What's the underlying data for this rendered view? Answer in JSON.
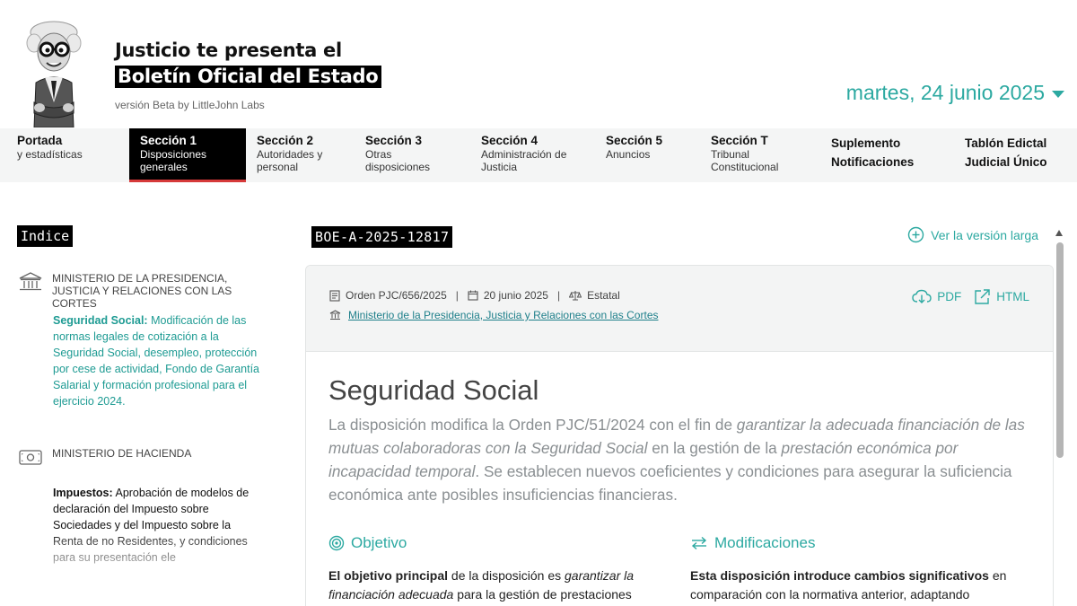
{
  "header": {
    "title_line1": "Justicio te presenta el",
    "title_line2": "Boletín Oficial del Estado",
    "version": "versión Beta by LittleJohn Labs",
    "date": "martes, 24 junio 2025"
  },
  "nav": [
    {
      "title": "Portada",
      "sub": "y estadísticas"
    },
    {
      "title": "Sección 1",
      "sub": "Disposiciones generales"
    },
    {
      "title": "Sección 2",
      "sub": "Autoridades y personal"
    },
    {
      "title": "Sección 3",
      "sub": "Otras disposiciones"
    },
    {
      "title": "Sección 4",
      "sub": "Administración de Justicia"
    },
    {
      "title": "Sección 5",
      "sub": "Anuncios"
    },
    {
      "title": "Sección T",
      "sub": "Tribunal Constitucional"
    },
    {
      "title": "Suplemento Notificaciones",
      "sub": ""
    },
    {
      "title": "Tablón Edictal Judicial Único",
      "sub": ""
    }
  ],
  "index": {
    "label": "Indice",
    "ministries": [
      {
        "name": "MINISTERIO DE LA PRESIDENCIA, JUSTICIA Y RELACIONES CON LAS CORTES",
        "icon": "government-building-icon",
        "entry_label": "Seguridad Social:",
        "entry_text": "Modificación de las normas legales de cotización a la Seguridad Social, desempleo, protección por cese de actividad, Fondo de Garantía Salarial y formación profesional para el ejercicio 2024."
      },
      {
        "name": "MINISTERIO DE HACIENDA",
        "icon": "banknote-icon",
        "entry_label": "Impuestos:",
        "entry_text": "Aprobación de modelos de declaración del Impuesto sobre Sociedades y del Impuesto sobre la Renta de no Residentes, y condiciones para su presentación ele"
      }
    ]
  },
  "document": {
    "id": "BOE-A-2025-12817",
    "long_version_label": "Ver la versión larga",
    "order": "Orden PJC/656/2025",
    "date": "20 junio 2025",
    "scope": "Estatal",
    "ministry_link": "Ministerio de la Presidencia, Justicia y Relaciones con las Cortes",
    "pdf_label": "PDF",
    "html_label": "HTML",
    "heading": "Seguridad Social",
    "lead": {
      "p1": "La disposición modifica la Orden PJC/51/2024 con el fin de ",
      "i1": "garantizar la adecuada financiación de las mutuas colaboradoras con la Seguridad Social",
      "p2": " en la gestión de la ",
      "i2": "prestación económica por incapacidad temporal",
      "p3": ". Se establecen nuevos coeficientes y condiciones para asegurar la suficiencia económica ante posibles insuficiencias financieras."
    },
    "objetivo": {
      "title": "Objetivo",
      "b": "El objetivo principal",
      "t1": " de la disposición es ",
      "i": "garantizar la financiación adecuada",
      "t2": " para la gestión de prestaciones"
    },
    "modificaciones": {
      "title": "Modificaciones",
      "b": "Esta disposición introduce cambios significativos",
      "t1": " en comparación con la normativa anterior, adaptando"
    }
  },
  "colors": {
    "accent": "#2ca9a1",
    "active_nav_bg": "#000000",
    "active_nav_underline": "#d63a3a"
  }
}
